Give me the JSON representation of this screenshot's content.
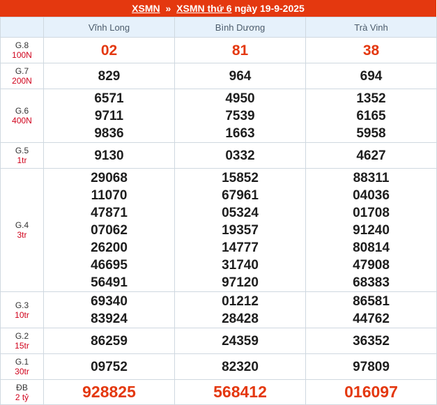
{
  "header": {
    "link1": "XSMN",
    "sep": "»",
    "link2": "XSMN thứ 6",
    "date_text": "ngày 19-9-2025"
  },
  "provinces": [
    "Vĩnh Long",
    "Bình Dương",
    "Trà Vinh"
  ],
  "rows": [
    {
      "code": "G.8",
      "prize": "100N",
      "height": 37,
      "style": "red",
      "values": [
        [
          "02"
        ],
        [
          "81"
        ],
        [
          "38"
        ]
      ]
    },
    {
      "code": "G.7",
      "prize": "200N",
      "height": 37,
      "style": "",
      "values": [
        [
          "829"
        ],
        [
          "964"
        ],
        [
          "694"
        ]
      ]
    },
    {
      "code": "G.6",
      "prize": "400N",
      "height": 77,
      "style": "",
      "values": [
        [
          "6571",
          "9711",
          "9836"
        ],
        [
          "4950",
          "7539",
          "1663"
        ],
        [
          "1352",
          "6165",
          "5958"
        ]
      ]
    },
    {
      "code": "G.5",
      "prize": "1tr",
      "height": 37,
      "style": "",
      "values": [
        [
          "9130"
        ],
        [
          "0332"
        ],
        [
          "4627"
        ]
      ]
    },
    {
      "code": "G.4",
      "prize": "3tr",
      "height": 177,
      "style": "",
      "values": [
        [
          "29068",
          "11070",
          "47871",
          "07062",
          "26200",
          "46695",
          "56491"
        ],
        [
          "15852",
          "67961",
          "05324",
          "19357",
          "14777",
          "31740",
          "97120"
        ],
        [
          "88311",
          "04036",
          "01708",
          "91240",
          "80814",
          "47908",
          "68383"
        ]
      ]
    },
    {
      "code": "G.3",
      "prize": "10tr",
      "height": 52,
      "style": "",
      "values": [
        [
          "69340",
          "83924"
        ],
        [
          "01212",
          "28428"
        ],
        [
          "86581",
          "44762"
        ]
      ]
    },
    {
      "code": "G.2",
      "prize": "15tr",
      "height": 37,
      "style": "",
      "values": [
        [
          "86259"
        ],
        [
          "24359"
        ],
        [
          "36352"
        ]
      ]
    },
    {
      "code": "G.1",
      "prize": "30tr",
      "height": 37,
      "style": "",
      "values": [
        [
          "09752"
        ],
        [
          "82320"
        ],
        [
          "97809"
        ]
      ]
    },
    {
      "code": "ĐB",
      "prize": "2 tỷ",
      "height": 36,
      "style": "big",
      "values": [
        [
          "928825"
        ],
        [
          "568412"
        ],
        [
          "016097"
        ]
      ]
    }
  ],
  "colors": {
    "header_bg": "#e4380f",
    "prize_red": "#d0021b",
    "head_bg": "#e6f1fb"
  }
}
